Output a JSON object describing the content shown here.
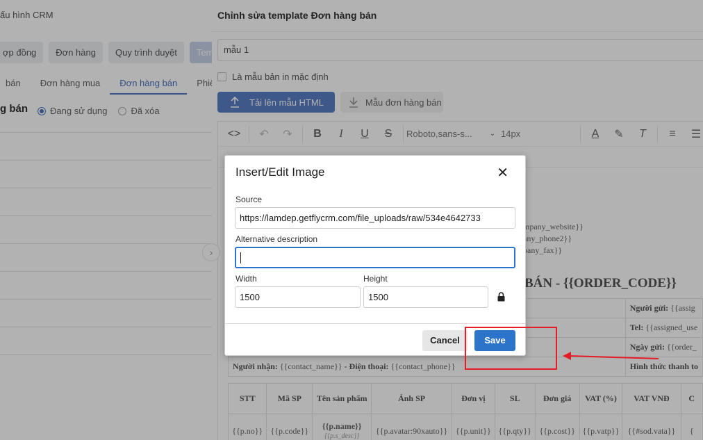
{
  "left": {
    "title": "ấu hình CRM",
    "tabs": [
      {
        "label": "ợp đồng",
        "active": false
      },
      {
        "label": "Đơn hàng",
        "active": false
      },
      {
        "label": "Quy trình duyệt",
        "active": false
      },
      {
        "label": "Templ",
        "active": true
      }
    ],
    "subtabs": [
      {
        "label": "bán",
        "active": false
      },
      {
        "label": "Đơn hàng mua",
        "active": false
      },
      {
        "label": "Đơn hàng bán",
        "active": true
      },
      {
        "label": "Phiếu t",
        "active": false
      }
    ],
    "heading": "g bán",
    "radios": [
      {
        "label": "Đang sử dụng",
        "checked": true
      },
      {
        "label": "Đã xóa",
        "checked": false
      }
    ]
  },
  "panel": {
    "title": "Chỉnh sửa template Đơn hàng bán",
    "name_value": "mẫu 1",
    "default_checkbox_label": "Là mẫu bản in mặc định",
    "upload_button": "Tải lên mẫu HTML",
    "sample_button": "Mẫu đơn hàng bán",
    "toolbar": {
      "font": "Roboto,sans-s...",
      "size": "14px"
    },
    "doc": {
      "company_lines": [
        "mpany_website}}",
        "any_phone2}}",
        "pany_fax}}"
      ],
      "order_heading": "BÁN - {{ORDER_CODE}}",
      "info_rows": [
        {
          "label": "Người gửi:",
          "value": "{{assig"
        },
        {
          "label": "Tel:",
          "value": "{{assigned_use"
        },
        {
          "label": "Ngày gửi:",
          "value": "{{order_"
        },
        {
          "label": "Hình thức thanh to",
          "value": ""
        }
      ],
      "recipient_label": "Người nhận:",
      "recipient_value": "{{contact_name}}",
      "phone_label": "- Điện thoại:",
      "phone_value": "{{contact_phone}}",
      "product_headers": [
        "STT",
        "Mã SP",
        "Tên sản phẩm",
        "Ảnh SP",
        "Đơn vị",
        "SL",
        "Đơn giá",
        "VAT (%)",
        "VAT VNĐ",
        "C"
      ],
      "product_row": [
        "{{p.no}}",
        "{{p.code}}",
        "{{p.name}}",
        "{{p.avatar:90xauto}}",
        "{{p.unit}}",
        "{{p.qty}}",
        "{{p.cost}}",
        "{{p.vatp}}",
        "{{#sod.vata}}",
        "{"
      ],
      "product_desc": "{{p.s_desc}}"
    }
  },
  "dialog": {
    "title": "Insert/Edit Image",
    "source_label": "Source",
    "source_value": "https://lamdep.getflycrm.com/file_uploads/raw/534e4642733",
    "alt_label": "Alternative description",
    "alt_value": "",
    "width_label": "Width",
    "width_value": "1500",
    "height_label": "Height",
    "height_value": "1500",
    "cancel": "Cancel",
    "save": "Save"
  },
  "colors": {
    "primary": "#2c74c9",
    "annotation": "#e41e26"
  }
}
